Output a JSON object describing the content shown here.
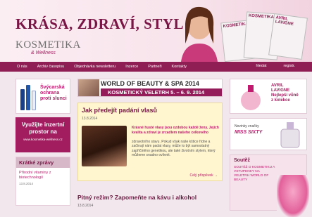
{
  "header": {
    "tagline": "KRÁSA, ZDRAVÍ, STYL",
    "logo": "KOSMETIKA",
    "logo_sub": "& Wellness",
    "magazines": [
      "KOSMETIKA",
      "KOSMETIKA",
      "AVRIL LAVIGNE"
    ]
  },
  "nav": {
    "items": [
      "O nás",
      "Archiv časopisu",
      "Objednávka newsletteru",
      "Inzerce",
      "Partneři",
      "Kontakty"
    ],
    "right": [
      "hledat",
      "registr."
    ]
  },
  "left": {
    "ad_text": "Švýcarská ochrana proti slunci",
    "promo_main": "Využijte inzertní prostor na",
    "promo_sub": "www.kosmetika-wellness.cz",
    "news_head": "Krátké zprávy",
    "news_title": "Přírodní vitaminy z biotechnologií",
    "news_date": "13.8.2014"
  },
  "banner": {
    "top": "WORLD OF BEAUTY & SPA 2014",
    "bottom": "KOSMETICKÝ VELETRH   5. – 6. 9. 2014"
  },
  "article": {
    "title": "Jak předejít padání vlasů",
    "meta": "13.8.2014",
    "lead": "Krásné husté vlasy jsou ozdobou každé ženy. Jejich kvalita a zdraví je zrcadlem našeho celkového",
    "body": "zdravotního stavu. Pokud však naše kštice řídne a začínají nám padat vlasy, může to být samostatný zapříčiněno genetikou, ale také životním stylem, který můžeme snadno ovlivnit.",
    "more": "Celý příspěvek →"
  },
  "article2": {
    "title": "Pitný režim? Zapomeňte na kávu i alkohol",
    "meta": "13.8.2014"
  },
  "right": {
    "box1_lines": [
      "AVRIL",
      "LAVIGNE",
      "Nejlepší vůně",
      "z kolekce"
    ],
    "box2_label": "Novinky značky",
    "box2_brand": "MISS SIXTY",
    "box3_head": "Soutěž",
    "box3_text": "SOUTĚŽ O KOSMETIKU A VSTUPENKY NA VELETRH WORLD OF BEAUTY"
  }
}
